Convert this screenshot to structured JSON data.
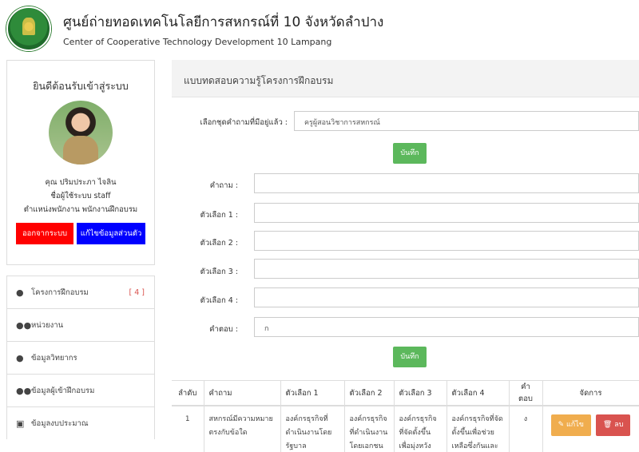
{
  "header": {
    "title": "ศูนย์ถ่ายทอดเทคโนโลยีการสหกรณ์ที่ 10 จังหวัดลำปาง",
    "subtitle": "Center of Cooperative Technology Development 10 Lampang"
  },
  "profile": {
    "welcome": "ยินดีต้อนรับเข้าสู่ระบบ",
    "name": "คุณ ปริมประภา ไจลิน",
    "username": "ชื่อผู้ใช้ระบบ staff",
    "position": "ตำแหน่งพนักงาน พนักงานฝึกอบรม",
    "logout_label": "ออกจากระบบ",
    "edit_label": "แก้ไขข้อมูลส่วนตัว"
  },
  "menu": {
    "items": [
      {
        "icon": "user-icon",
        "label": "โครงการฝึกอบรม",
        "count": "[ 4 ]"
      },
      {
        "icon": "users-icon",
        "label": "หน่วยงาน",
        "count": ""
      },
      {
        "icon": "user-icon",
        "label": "ข้อมูลวิทยากร",
        "count": ""
      },
      {
        "icon": "users-icon",
        "label": "ข้อมูลผู้เข้าฝึกอบรม",
        "count": ""
      },
      {
        "icon": "money-icon",
        "label": "ข้อมูลงบประมาณ",
        "count": ""
      }
    ]
  },
  "panel": {
    "title": "แบบทดสอบความรู้โครงการฝึกอบรม"
  },
  "form": {
    "preset_label": "เลือกชุดคำถามที่มีอยู่แล้ว :",
    "preset_value": "ครูผู้สอนวิชาการสหกรณ์",
    "save_label": "บันทึก",
    "question_label": "คำถาม :",
    "option1_label": "ตัวเลือก 1 :",
    "option2_label": "ตัวเลือก 2 :",
    "option3_label": "ตัวเลือก 3 :",
    "option4_label": "ตัวเลือก 4 :",
    "answer_label": "คำตอบ :",
    "answer_value": "ก",
    "save2_label": "บันทึก"
  },
  "table": {
    "headers": [
      "ลำดับ",
      "คำถาม",
      "ตัวเลือก 1",
      "ตัวเลือก 2",
      "ตัวเลือก 3",
      "ตัวเลือก 4",
      "คำตอบ",
      "จัดการ"
    ],
    "rows": [
      {
        "no": "1",
        "question": "สหกรณ์มีความหมายตรงกับข้อใด",
        "opt1": "องค์กรธุรกิจที่ดำเนินงานโดยรัฐบาล",
        "opt2": "องค์กรธุรกิจที่ดำเนินงานโดยเอกชน",
        "opt3": "องค์กรธุรกิจที่จัดตั้งขึ้นเพื่อมุ่งหวังกำไร",
        "opt4": "องค์กรธุรกิจที่จัดตั้งขึ้นเพื่อช่วยเหลือซึ่งกันและกัน",
        "answer": "ง",
        "edit_label": "แก้ไข",
        "delete_label": "ลบ"
      }
    ]
  }
}
